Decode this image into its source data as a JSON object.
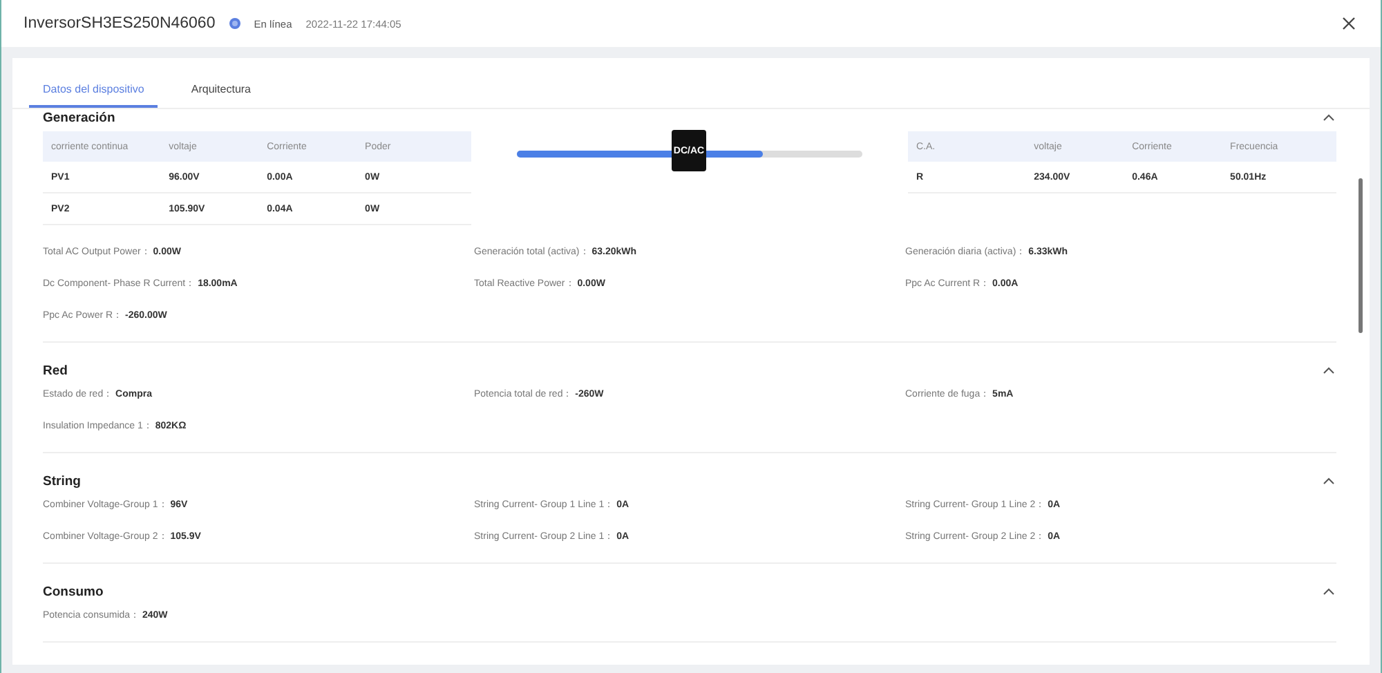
{
  "window": {
    "title": "InversorSH3ES250N46060",
    "status": "En línea",
    "timestamp": "2022-11-22 17:44:05"
  },
  "tabs": [
    {
      "label": "Datos del dispositivo",
      "selected": true
    },
    {
      "label": "Arquitectura",
      "selected": false
    }
  ],
  "sections": [
    {
      "title": "Generación",
      "expanded": true,
      "dc_table": {
        "columns": [
          "corriente continua",
          "voltaje",
          "Corriente",
          "Poder"
        ],
        "rows": [
          [
            "PV1",
            "96.00V",
            "0.00A",
            "0W"
          ],
          [
            "PV2",
            "105.90V",
            "0.04A",
            "0W"
          ]
        ]
      },
      "converter": {
        "label": "DC/AC",
        "level": 0.71
      },
      "ac_table": {
        "columns": [
          "C.A.",
          "voltaje",
          "Corriente",
          "Frecuencia"
        ],
        "rows": [
          [
            "R",
            "234.00V",
            "0.46A",
            "50.01Hz"
          ]
        ]
      },
      "fields": [
        {
          "label": "Total AC Output Power：",
          "value": "0.00W"
        },
        {
          "label": "Generación total (activa)：",
          "value": "63.20kWh"
        },
        {
          "label": "Generación diaria (activa)：",
          "value": "6.33kWh"
        },
        {
          "label": "Dc Component- Phase R Current：",
          "value": "18.00mA"
        },
        {
          "label": "Total Reactive Power：",
          "value": "0.00W"
        },
        {
          "label": "Ppc Ac Current R：",
          "value": "0.00A"
        },
        {
          "label": "Ppc Ac Power R：",
          "value": "-260.00W"
        }
      ]
    },
    {
      "title": "Red",
      "expanded": true,
      "fields": [
        {
          "label": "Estado de red：",
          "value": "Compra"
        },
        {
          "label": "Potencia total de red：",
          "value": "-260W"
        },
        {
          "label": "Corriente de fuga：",
          "value": "5mA"
        },
        {
          "label": "Insulation Impedance 1：",
          "value": "802KΩ"
        }
      ]
    },
    {
      "title": "String",
      "expanded": true,
      "fields": [
        {
          "label": "Combiner Voltage-Group 1：",
          "value": "96V"
        },
        {
          "label": "String Current- Group 1 Line 1：",
          "value": "0A"
        },
        {
          "label": "String Current- Group 1 Line 2：",
          "value": "0A"
        },
        {
          "label": "Combiner Voltage-Group 2：",
          "value": "105.9V"
        },
        {
          "label": "String Current- Group 2 Line 1：",
          "value": "0A"
        },
        {
          "label": "String Current- Group 2 Line 2：",
          "value": "0A"
        }
      ]
    },
    {
      "title": "Consumo",
      "expanded": true,
      "fields": [
        {
          "label": "Potencia consumida：",
          "value": "240W"
        }
      ]
    }
  ]
}
